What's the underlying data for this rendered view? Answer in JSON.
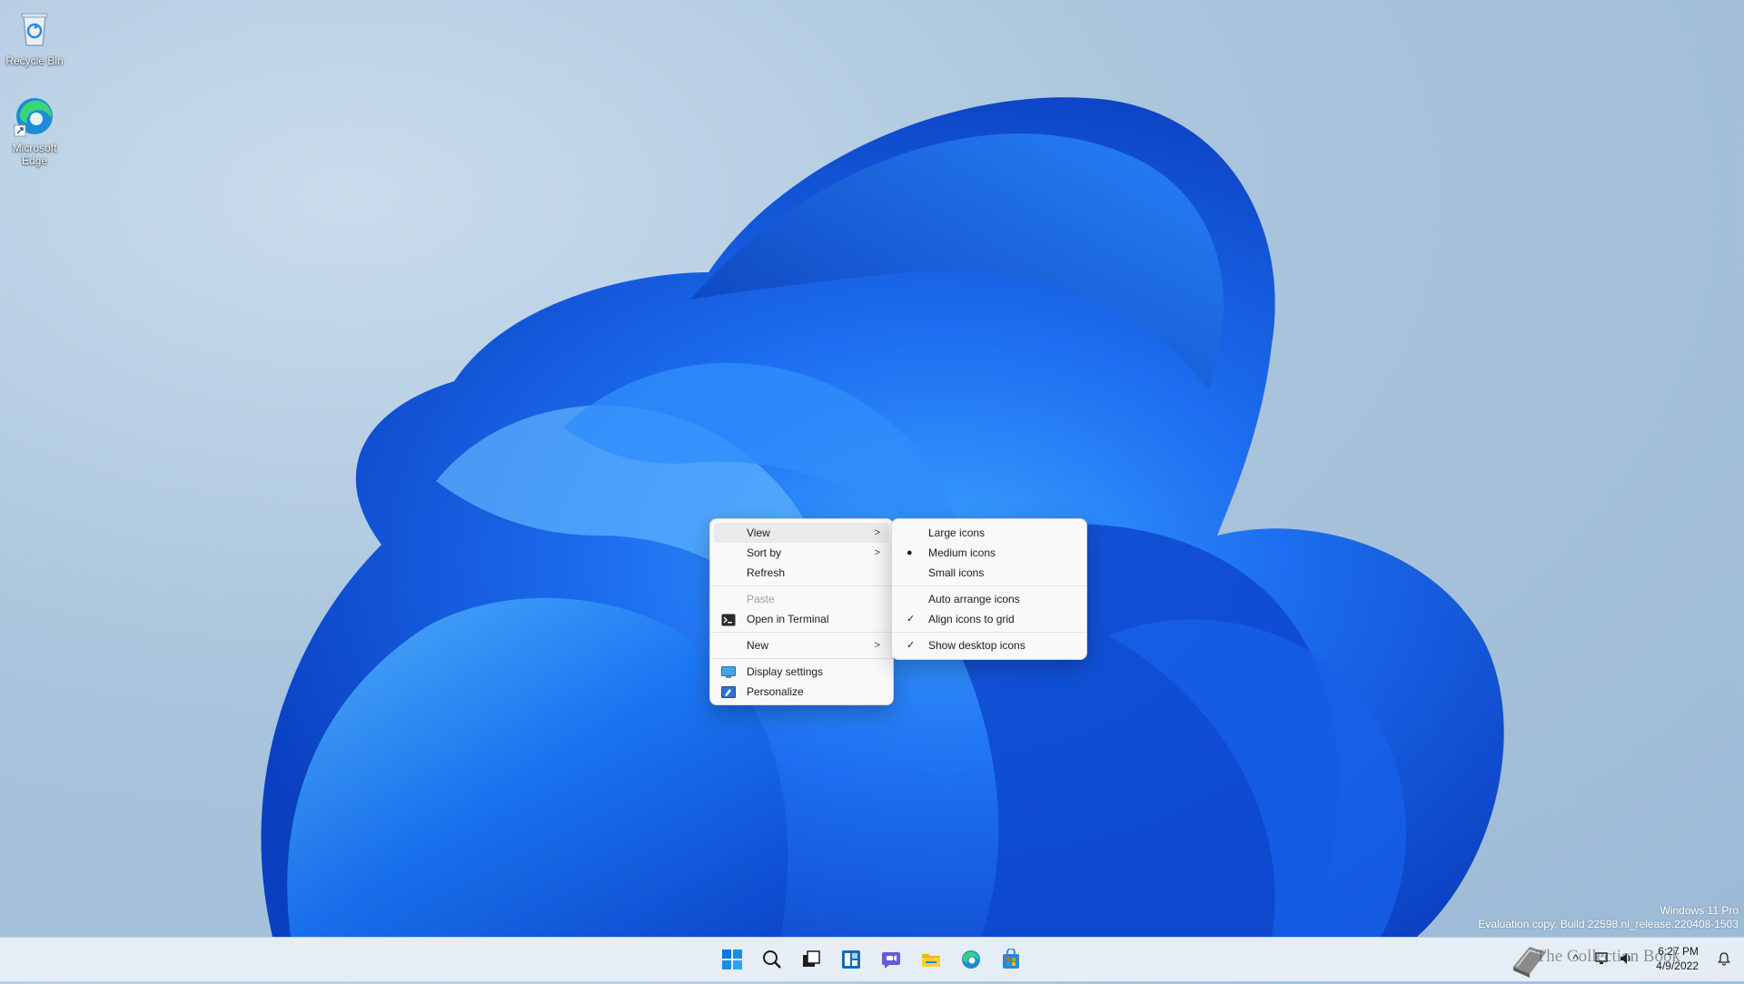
{
  "desktop": {
    "icons": [
      {
        "label": "Recycle Bin"
      },
      {
        "label": "Microsoft Edge"
      }
    ]
  },
  "watermark": {
    "line1": "Windows 11 Pro",
    "line2": "Evaluation copy. Build 22598.ni_release.220408-1503"
  },
  "context_menu": {
    "items": [
      {
        "label": "View",
        "has_submenu": true,
        "highlighted": true
      },
      {
        "label": "Sort by",
        "has_submenu": true
      },
      {
        "label": "Refresh"
      },
      {
        "label": "Paste",
        "disabled": true
      },
      {
        "label": "Open in Terminal",
        "icon": "terminal-icon"
      },
      {
        "label": "New",
        "has_submenu": true
      },
      {
        "label": "Display settings",
        "icon": "display-icon"
      },
      {
        "label": "Personalize",
        "icon": "personalize-icon"
      }
    ],
    "arrow": ">"
  },
  "view_submenu": {
    "items": [
      {
        "label": "Large icons"
      },
      {
        "label": "Medium icons",
        "mark": "●"
      },
      {
        "label": "Small icons"
      },
      {
        "label": "Auto arrange icons"
      },
      {
        "label": "Align icons to grid",
        "mark": "✓"
      },
      {
        "label": "Show desktop icons",
        "mark": "✓"
      }
    ]
  },
  "taskbar": {
    "apps": [
      "start-icon",
      "search-icon",
      "task-view-icon",
      "widgets-icon",
      "chat-icon",
      "file-explorer-icon",
      "edge-icon",
      "store-icon"
    ],
    "tray": {
      "chevron": "^",
      "time": "6:27 PM",
      "date": "4/9/2022",
      "overlay_text": "The Collection Book"
    }
  },
  "colors": {
    "accent": "#0067c0",
    "wallpaper_blue": "#1e6bf0"
  }
}
